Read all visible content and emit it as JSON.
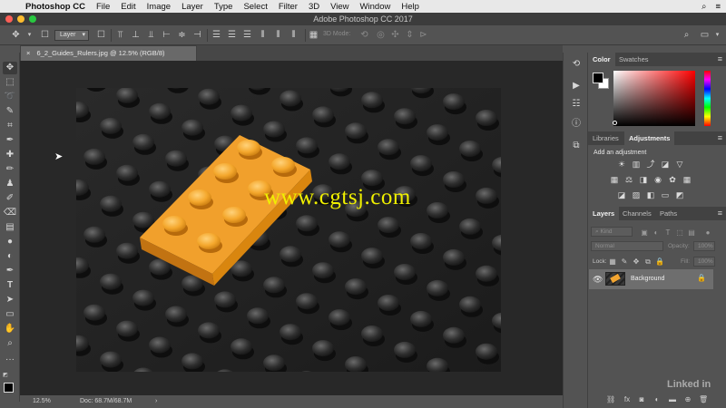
{
  "menubar": {
    "app_name": "Photoshop CC",
    "items": [
      "File",
      "Edit",
      "Image",
      "Layer",
      "Type",
      "Select",
      "Filter",
      "3D",
      "View",
      "Window",
      "Help"
    ]
  },
  "titlebar": {
    "title": "Adobe Photoshop CC 2017"
  },
  "options": {
    "auto_select_value": "Layer",
    "mode_3d_label": "3D Mode:"
  },
  "document": {
    "tab_label": "6_2_Guides_Rulers.jpg @ 12.5% (RGB/8)",
    "watermark": "www.cgtsj.com"
  },
  "status": {
    "zoom": "12.5%",
    "doc_size": "Doc: 68.7M/68.7M",
    "arrow": "›"
  },
  "panels": {
    "color_tabs": [
      "Color",
      "Swatches"
    ],
    "adj_tabs": [
      "Libraries",
      "Adjustments"
    ],
    "add_adjustment": "Add an adjustment",
    "layer_tabs": [
      "Layers",
      "Channels",
      "Paths"
    ],
    "kind_filter": "Kind",
    "blend_mode": "Normal",
    "opacity_label": "Opacity:",
    "opacity_value": "100%",
    "lock_label": "Lock:",
    "fill_label": "Fill:",
    "fill_value": "100%",
    "layer_name": "Background"
  },
  "watermark_corner": "Linked in",
  "colors": {
    "accent_yellow": "#f0f000",
    "lego_orange": "#f2a531",
    "panel_bg": "#535353",
    "canvas_bg": "#282828"
  }
}
